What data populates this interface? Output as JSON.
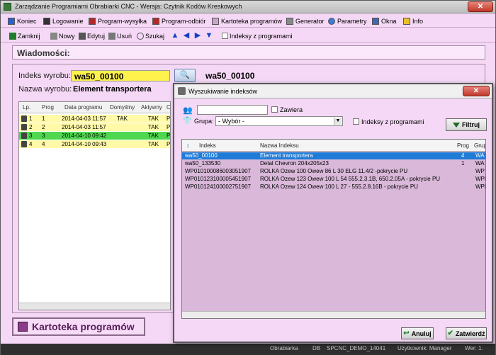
{
  "window": {
    "title": "Zarządzanie Programiami Obrabiarki CNC - Wersja: Czytnik Kodów Kreskowych",
    "close_label": "✕"
  },
  "menu": [
    "Koniec",
    "Logowanie",
    "Program-wysyłka",
    "Program-odbiór",
    "Kartoteka programów",
    "Generator",
    "Parametry",
    "Okna",
    "Info"
  ],
  "toolbar": {
    "zamknij": "Zamknij",
    "nowy": "Nowy",
    "edytuj": "Edytuj",
    "usun": "Usuń",
    "szukaj": "Szukaj",
    "indeksy": "Indeksy z programami"
  },
  "messages_label": "Wiadomości:",
  "main": {
    "index_label": "Indeks wyrobu:",
    "index_value": "wa50_00100",
    "index_echo": "wa50_00100",
    "name_label": "Nazwa wyrobu:",
    "name_value": "Element transportera",
    "grid": {
      "headers": [
        "Lp.",
        "Prog",
        "Data programu",
        "Domyślny",
        "Aktywny",
        "O"
      ],
      "rows": [
        {
          "lp": "1",
          "prog": "1",
          "data": "2014-04-03 11:57",
          "domyslny": "TAK",
          "aktywny": "TAK",
          "o": "P"
        },
        {
          "lp": "2",
          "prog": "2",
          "data": "2014-04-03 11:57",
          "domyslny": "",
          "aktywny": "TAK",
          "o": "P"
        },
        {
          "lp": "3",
          "prog": "3",
          "data": "2014-04-10 09:42",
          "domyslny": "",
          "aktywny": "TAK",
          "o": "P"
        },
        {
          "lp": "4",
          "prog": "4",
          "data": "2014-04-10 09:43",
          "domyslny": "",
          "aktywny": "TAK",
          "o": "P"
        }
      ]
    }
  },
  "kartoteka_label": "Kartoteka programów",
  "dialog": {
    "title": "Wyszukiwanie indeksów",
    "search_value": "",
    "zawiera_label": "Zawiera",
    "grupa_label": "Grupa:",
    "grupa_value": "- Wybór -",
    "indeksy_label": "Indeksy z programami",
    "filtruj_label": "Filtruj",
    "headers": [
      "Indeks",
      "Nazwa Indeksu",
      "Prog",
      "Grup"
    ],
    "rows": [
      {
        "indeks": "wa50_00100",
        "nazwa": "Element transportera",
        "prog": "4",
        "grup": "WA"
      },
      {
        "indeks": "wa50_133530",
        "nazwa": "Detal Chevron 204x205x23",
        "prog": "1",
        "grup": "WA"
      },
      {
        "indeks": "WP010100086003051907",
        "nazwa": "ROLKA Ozew 100 Owew 86  L 30 ELG 11.4/2 -pokrycie PU",
        "prog": "",
        "grup": "WP"
      },
      {
        "indeks": "WP010123100005451907",
        "nazwa": "ROLKA Ozew 123 Owew 100 L 54  555.2.3.1B, 650.2.05A - pokrycie PU",
        "prog": "",
        "grup": "WPF"
      },
      {
        "indeks": "WP010124100002751907",
        "nazwa": "ROLKA Ozew 124 Owew 100 L 27 - 555.2.8.16B - pokrycie PU",
        "prog": "",
        "grup": "WPF"
      }
    ],
    "anuluj_label": "Anuluj",
    "zatwierdz_label": "Zatwierdź"
  },
  "status": [
    "Obrabiarka",
    "DB",
    "SPCNC_DEMO_14041",
    "Użytkownik: Manager",
    "Wer: 1."
  ]
}
